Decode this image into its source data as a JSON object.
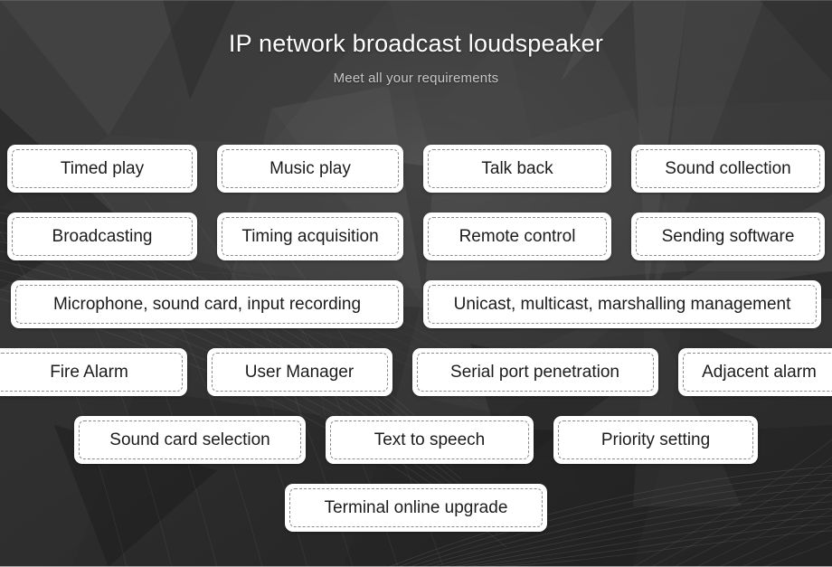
{
  "header": {
    "title": "IP network broadcast loudspeaker",
    "subtitle": "Meet all your requirements"
  },
  "colors": {
    "background_dark": "#2b2b2b",
    "background_light": "#4a4a4a",
    "pill_background": "#ffffff",
    "pill_border_dashed": "#8d8d8d",
    "pill_text": "#1c1c1c",
    "title_text": "#ffffff",
    "subtitle_text": "#c6c6c6"
  },
  "features": {
    "rows": [
      {
        "items": [
          {
            "label": "Timed play",
            "width_class": "w-210"
          },
          {
            "label": "Music play",
            "width_class": "w-206"
          },
          {
            "label": "Talk back",
            "width_class": "w-208"
          },
          {
            "label": "Sound collection",
            "width_class": "w-214"
          }
        ]
      },
      {
        "items": [
          {
            "label": "Broadcasting",
            "width_class": "w-210"
          },
          {
            "label": "Timing acquisition",
            "width_class": "w-206"
          },
          {
            "label": "Remote control",
            "width_class": "w-208"
          },
          {
            "label": "Sending software",
            "width_class": "w-214"
          }
        ]
      },
      {
        "items": [
          {
            "label": "Microphone, sound card, input recording",
            "width_class": "w-434"
          },
          {
            "label": "Unicast, multicast, marshalling management",
            "width_class": "w-440"
          }
        ]
      },
      {
        "items": [
          {
            "label": "Fire Alarm",
            "width_class": "w-216"
          },
          {
            "label": "User Manager",
            "width_class": "w-205"
          },
          {
            "label": "Serial port penetration",
            "width_class": "w-272"
          },
          {
            "label": "Adjacent alarm",
            "width_class": "w-180"
          }
        ]
      },
      {
        "items": [
          {
            "label": "Sound card selection",
            "width_class": "w-256"
          },
          {
            "label": "Text to speech",
            "width_class": "w-230"
          },
          {
            "label": "Priority setting",
            "width_class": "w-226"
          }
        ]
      },
      {
        "items": [
          {
            "label": "Terminal online upgrade",
            "width_class": "w-290"
          }
        ]
      }
    ]
  }
}
